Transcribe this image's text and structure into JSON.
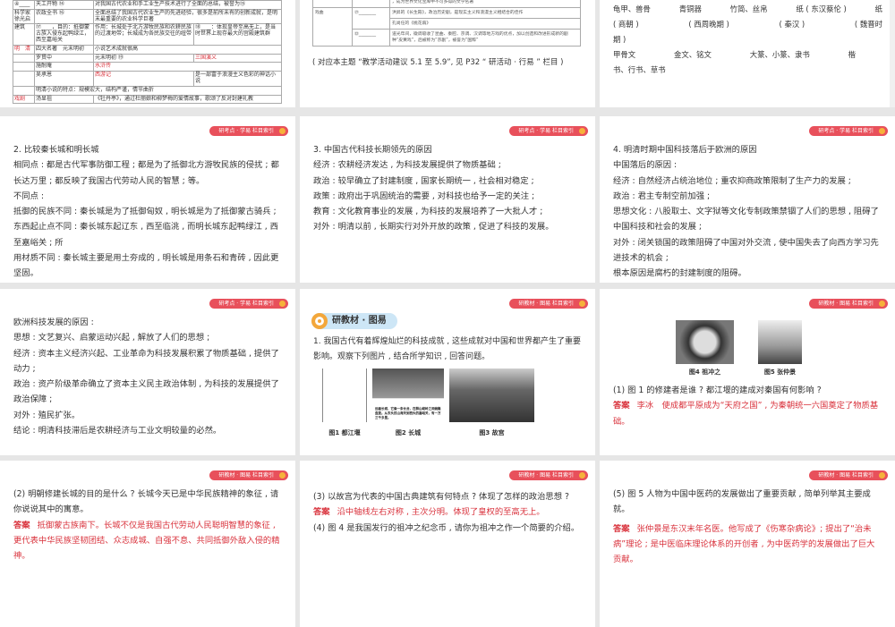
{
  "badges": {
    "kaodian": "研考点 · 学易  栏目索引",
    "jiaocai": "研教材 · 图易  栏目索引"
  },
  "s1": {
    "rows": [
      [
        "④____",
        "天工开物 ⑭",
        "对我国古代农业和手工业生产技术进行了全面的总结，被誉为⑮"
      ],
      [
        "科学家 徐光启",
        "农政全书 ⑯",
        "全面总结了我国古代农业生产的先进经验，很多是前所未有的创新成就，是明末最重要的农业科学巨著"
      ],
      [
        "建筑",
        "⑰____，目的：抵御蒙古族入侵东起鸭绿江，西至嘉峪关",
        "作用：长城处于北方游牧民族和农耕民族的过渡地带；长城成为各民族交往的纽带",
        "⑱____：体现皇帝至高无上，是当时世界上现存最大的宫殿建筑群"
      ],
      [
        "文 学",
        "明　清",
        "四大名著　元末明初",
        "小说艺术成就很高"
      ],
      [
        "",
        "罗贯中",
        "元末明初 ⑲",
        "三国演义"
      ],
      [
        "",
        "施耐庵",
        "⑳",
        "水浒传"
      ],
      [
        "",
        "吴承恩",
        "西游记",
        "是一部富于浪漫主义色彩的神话小说"
      ],
      [
        "",
        "明清小说的特点：规模宏大，结构严谨，情节曲折",
        "",
        ""
      ],
      [
        "戏剧",
        "汤显祖",
        "《牡丹亭》，通过杜丽娘和柳梦梅的爱情故事，歌颂了反对封建礼教"
      ]
    ]
  },
  "s2": {
    "row0": "，成为世界文化宝库中不可多得的文学名著",
    "genre": "戏曲",
    "blank1": "㉑________",
    "r1": "洪昇的《长生殿》，政治历史剧，是现实主义和浪漫主义相结合的佳作",
    "r2": "孔尚任的《桃花扇》",
    "blank2": "㉒________",
    "r3": "道光年间，徽调吸收了昆曲、秦腔、京调、汉调等地方戏的优点，加以创造和改进形成新的剧种“皮黄戏”，后被称为“京剧”，被誉为“国粹”",
    "note": "( 对应本主题 “教学活动建议 5.1 至 5.9”, 见 P32 “ 研活动 · 行易 ” 栏目 )"
  },
  "s3": {
    "materials": [
      "龟甲、兽骨",
      "青铜器",
      "竹简、丝帛",
      "纸 ( 东汉蔡伦 )",
      "纸"
    ],
    "periods": [
      "( 商朝 )",
      "( 西周晚期 )",
      "( 秦汉 )",
      "( 魏晋时"
    ],
    "periods_cont": "期 )",
    "scripts": [
      "甲骨文",
      "金文、铭文",
      "大篆、小篆、隶书",
      "楷"
    ],
    "scripts_cont": "书、行书、草书"
  },
  "s4": {
    "lines": [
      "2. 比较秦长城和明长城",
      "相同点 : 都是古代军事防御工程 ; 都是为了抵御北方游牧民族的侵扰 ; 都长达万里 ; 都反映了我国古代劳动人民的智慧 ; 等。",
      "不同点 :",
      "抵御的民族不同 : 秦长城是为了抵御匈奴 , 明长城是为了抵御蒙古骑兵 ; 东西起止点不同 : 秦长城东起辽东 , 西至临洮 , 而明长城东起鸭绿江 , 西至嘉峪关 ; 所",
      "用材质不同 : 秦长城主要是用土夯成的 , 明长城是用条石和青砖 , 因此更坚固。"
    ]
  },
  "s5": {
    "lines": [
      "3. 中国古代科技长期领先的原因",
      "经济 : 农耕经济发达 , 为科技发展提供了物质基础 ;",
      "政治 : 较早确立了封建制度 , 国家长期统一 , 社会相对稳定 ;",
      "政策 : 政府出于巩固统治的需要 , 对科技也给予一定的关注 ;",
      "教育 : 文化教育事业的发展 , 为科技的发展培养了一大批人才 ;",
      "对外 : 明清以前 , 长期实行对外开放的政策 , 促进了科技的发展。"
    ]
  },
  "s6": {
    "lines": [
      "4. 明清时期中国科技落后于欧洲的原因",
      "中国落后的原因 :",
      "经济 : 自然经济占统治地位 ; 重农抑商政策限制了生产力的发展 ;",
      "政治 : 君主专制空前加强 ;",
      "思想文化 : 八股取士、文字狱等文化专制政策禁锢了人们的思想 , 阻碍了中国科技和社会的发展 ;",
      "对外 : 闭关锁国的政策阻碍了中国对外交流 , 使中国失去了向西方学习先进技术的机会 ;",
      "根本原因是腐朽的封建制度的阻碍。"
    ]
  },
  "s7": {
    "lines": [
      "欧洲科技发展的原因 :",
      "思想 : 文艺复兴、启蒙运动兴起 , 解放了人们的思想 ;",
      "经济 : 资本主义经济兴起、工业革命为科技发展积累了物质基础 , 提供了动力 ;",
      "政治 : 资产阶级革命确立了资本主义民主政治体制 , 为科技的发展提供了政治保障 ;",
      "对外 : 殖民扩张。",
      "结论 : 明清科技滞后是农耕经济与工业文明较量的必然。"
    ]
  },
  "s8": {
    "section": "研教材 · 图易",
    "q": "1. 我国古代有着辉煌灿烂的科技成就 , 这些成就对中国和世界都产生了重要影响。观察下列图片 , 结合所学知识 , 回答问题。",
    "fig1": "图1 都江堰",
    "fig2": "图2 长城",
    "fig2_caption": "远看长城，它像一条长龙，在群山峻岭之间蜿蜒盘旋。从东头的山海关到西头的嘉峪关，有一万三千多里。",
    "fig3": "图3 故宫"
  },
  "s9": {
    "fig4": "图4 祖冲之",
    "fig5": "图5 张仲景",
    "q": "(1) 图 1 的修建者是谁 ? 都江堰的建成对秦国有何影响 ?",
    "ans_label": "答案",
    "ans": "李冰　使成都平原成为“天府之国” , 为秦朝统一六国奠定了物质基础。"
  },
  "s10": {
    "q": "(2) 明朝修建长城的目的是什么 ? 长城今天已是中华民族精神的象征 , 请你说说其中的寓意。",
    "ans_label": "答案",
    "ans": "抵御蒙古族南下。长城不仅是我国古代劳动人民聪明智慧的象征 , 更代表中华民族坚韧团结、众志成城、自强不息、共同抵御外敌入侵的精神。"
  },
  "s11": {
    "q1": "(3) 以故宫为代表的中国古典建筑有何特点 ? 体现了怎样的政治思想 ?",
    "ans_label": "答案",
    "ans": "沿中轴线左右对称 , 主次分明。体现了皇权的至高无上。",
    "q2": "(4) 图 4 是我国发行的祖冲之纪念币 , 请你为祖冲之作一个简要的介绍。"
  },
  "s12": {
    "q": "(5) 图 5 人物为中国中医药的发展做出了重要贡献 , 简单列举其主要成就。",
    "ans_label": "答案",
    "ans": "张仲景是东汉末年名医。他写成了《伤寒杂病论》; 提出了“治未病”理论 ; 是中医临床理论体系的开创者 , 为中医药学的发展做出了巨大贡献。"
  }
}
